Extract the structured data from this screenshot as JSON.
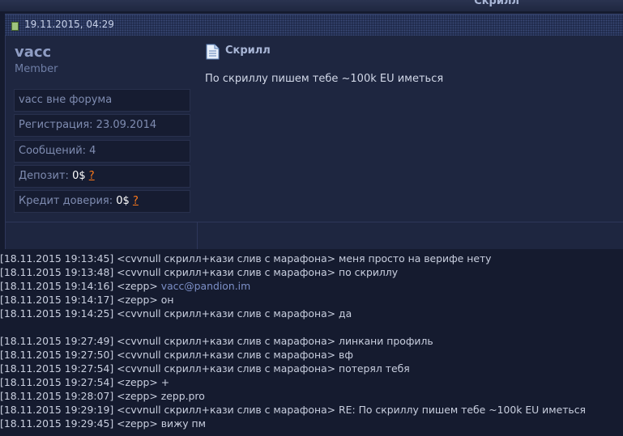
{
  "header": {
    "title": "Скрилл"
  },
  "post": {
    "date": "19.11.2015, 04:29",
    "user": {
      "name": "vacc",
      "title": "Member",
      "status": "vacc вне форума",
      "registration": "Регистрация: 23.09.2014",
      "messages": "Сообщений: 4",
      "deposit_label": "Депозит:",
      "deposit_value": "0$",
      "deposit_help": "?",
      "credit_label": "Кредит доверия:",
      "credit_value": "0$",
      "credit_help": "?"
    },
    "message": {
      "title": "Скрилл",
      "body": "По скриллу пишем тебе ~100k EU иметься"
    }
  },
  "chat_log": [
    {
      "ts": "[18.11.2015 19:13:45]",
      "nick": "<cvvnull скрилл+кази слив с марафона>",
      "text": "меня просто на верифе нету"
    },
    {
      "ts": "[18.11.2015 19:13:48]",
      "nick": "<cvvnull скрилл+кази слив с марафона>",
      "text": "по скриллу"
    },
    {
      "ts": "[18.11.2015 19:14:16]",
      "nick": "<zepp>",
      "text": "vacc@pandion.im",
      "link": true
    },
    {
      "ts": "[18.11.2015 19:14:17]",
      "nick": "<zepp>",
      "text": "он"
    },
    {
      "ts": "[18.11.2015 19:14:25]",
      "nick": "<cvvnull скрилл+кази слив с марафона>",
      "text": "да"
    },
    {
      "gap": true
    },
    {
      "ts": "[18.11.2015 19:27:49]",
      "nick": "<cvvnull скрилл+кази слив с марафона>",
      "text": "линкани профиль"
    },
    {
      "ts": "[18.11.2015 19:27:50]",
      "nick": "<cvvnull скрилл+кази слив с марафона>",
      "text": "вф"
    },
    {
      "ts": "[18.11.2015 19:27:54]",
      "nick": "<cvvnull скрилл+кази слив с марафона>",
      "text": "потерял тебя"
    },
    {
      "ts": "[18.11.2015 19:27:54]",
      "nick": "<zepp>",
      "text": "+"
    },
    {
      "ts": "[18.11.2015 19:28:07]",
      "nick": "<zepp>",
      "text": "zepp.pro"
    },
    {
      "ts": "[18.11.2015 19:29:19]",
      "nick": "<cvvnull скрилл+кази слив с марафона>",
      "text": "RE: По скриллу пишем тебе ~100k EU иметься"
    },
    {
      "ts": "[18.11.2015 19:29:45]",
      "nick": "<zepp>",
      "text": "вижу пм"
    }
  ]
}
